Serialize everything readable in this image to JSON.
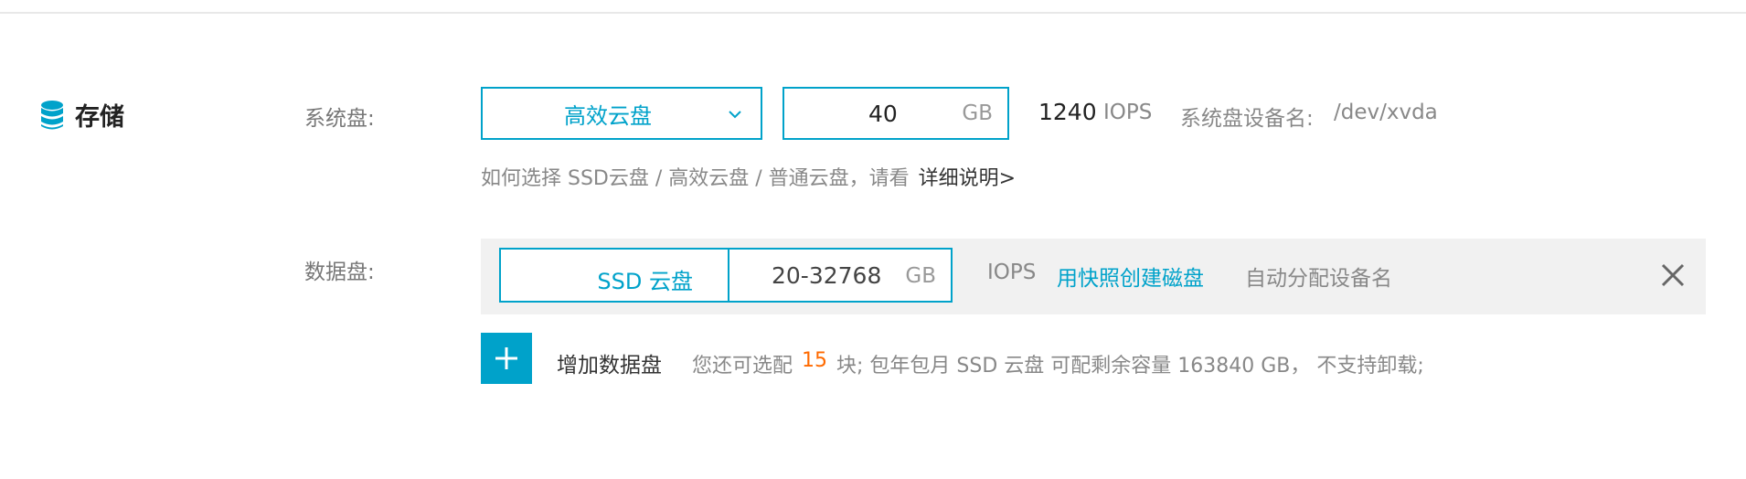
{
  "section": {
    "title": "存储",
    "icon": "database-icon"
  },
  "system_disk": {
    "label": "系统盘:",
    "type_selected": "高效云盘",
    "size_value": "40",
    "size_unit": "GB",
    "iops_value": "1240",
    "iops_label": "IOPS",
    "device_label": "系统盘设备名:",
    "device_path": "/dev/xvda",
    "hint_text": "如何选择 SSD云盘 / 高效云盘 / 普通云盘，请看",
    "hint_link": "详细说明>"
  },
  "data_disk": {
    "label": "数据盘:",
    "type_label": "SSD 云盘",
    "size_value": "20-32768",
    "size_unit": "GB",
    "iops_label": "IOPS",
    "snapshot_link": "用快照创建磁盘",
    "auto_device": "自动分配设备名",
    "close_icon": "close-icon"
  },
  "add_disk": {
    "icon": "plus-icon",
    "label": "增加数据盘",
    "quota_prefix": "您还可选配",
    "quota_count": "15",
    "quota_suffix": "块; 包年包月 SSD 云盘 可配剩余容量 163840 GB， 不支持卸载;"
  },
  "colors": {
    "accent": "#00a2ca",
    "highlight": "#ff6a00",
    "panel_bg": "#f1f1f1"
  }
}
